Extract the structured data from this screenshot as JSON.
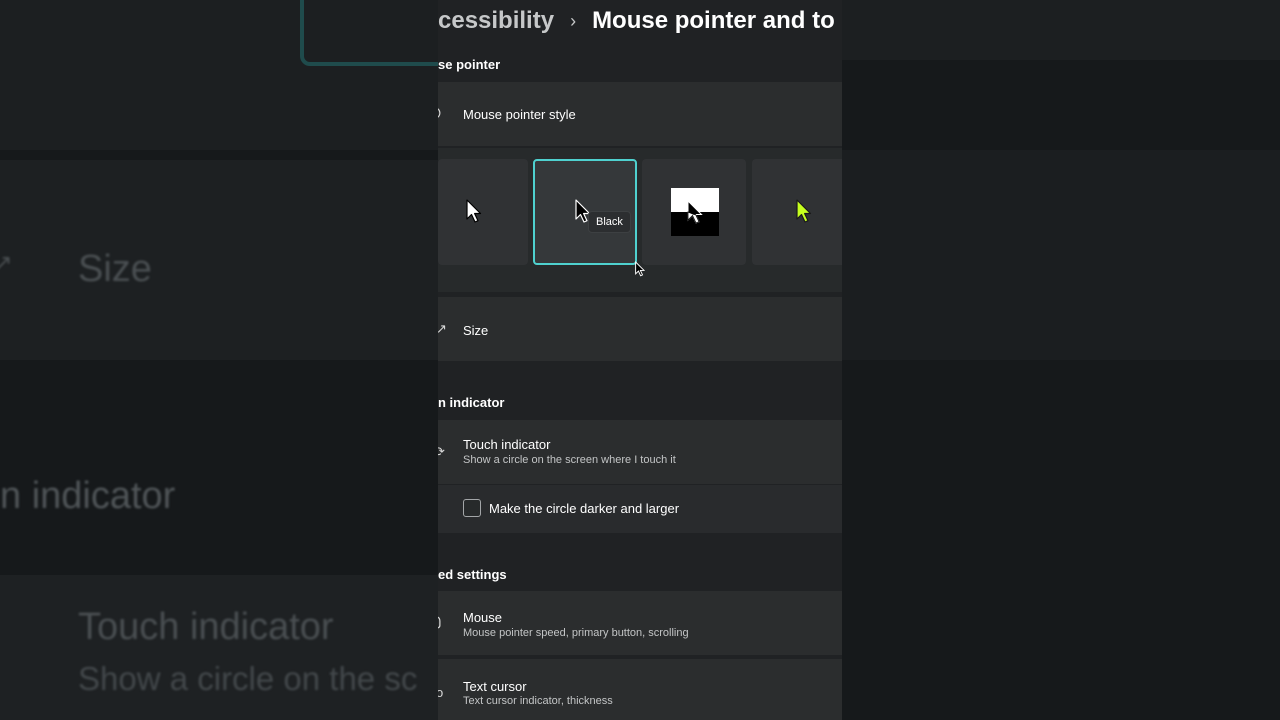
{
  "background": {
    "size_text": "Size",
    "indicator_text": "n indicator",
    "touch_title": "Touch indicator",
    "touch_sub": "Show a circle on the sc"
  },
  "breadcrumb": {
    "parent": "cessibility",
    "separator": "›",
    "current": "Mouse pointer and to"
  },
  "mouse_pointer_section": {
    "heading": "se pointer",
    "style_label": "Mouse pointer style",
    "styles": [
      {
        "name": "white",
        "selected": false
      },
      {
        "name": "black",
        "selected": true,
        "tooltip": "Black"
      },
      {
        "name": "inverted",
        "selected": false
      },
      {
        "name": "custom",
        "selected": false,
        "color": "#c6ff1f"
      }
    ],
    "size_label": "Size"
  },
  "touch_section": {
    "heading": "n indicator",
    "title": "Touch indicator",
    "description": "Show a circle on the screen where I touch it",
    "checkbox_label": "Make the circle darker and larger",
    "checkbox_checked": false
  },
  "related_section": {
    "heading": "ed settings",
    "items": [
      {
        "title": "Mouse",
        "description": "Mouse pointer speed, primary button, scrolling"
      },
      {
        "title": "Text cursor",
        "description": "Text cursor indicator, thickness"
      }
    ]
  },
  "colors": {
    "accent": "#4fd1cf",
    "custom_pointer": "#c6ff1f"
  }
}
